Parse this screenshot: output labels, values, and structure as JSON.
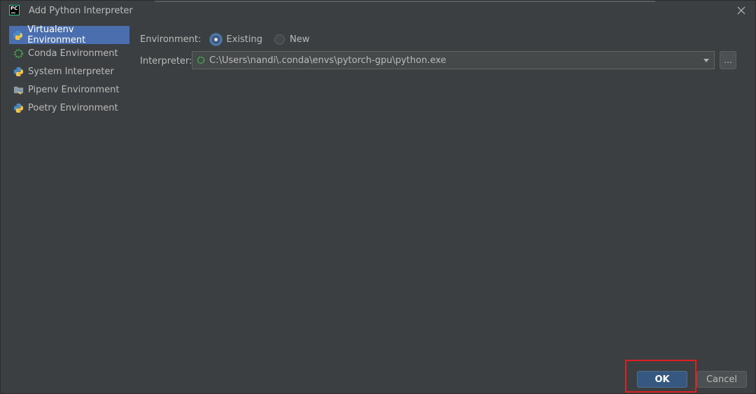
{
  "window": {
    "title": "Add Python Interpreter",
    "app_icon_text": "PC"
  },
  "sidebar": {
    "items": [
      {
        "label": "Virtualenv Environment",
        "icon": "python-icon",
        "selected": true
      },
      {
        "label": "Conda Environment",
        "icon": "conda-ring-icon",
        "selected": false
      },
      {
        "label": "System Interpreter",
        "icon": "python-icon",
        "selected": false
      },
      {
        "label": "Pipenv Environment",
        "icon": "pipenv-folder-icon",
        "selected": false
      },
      {
        "label": "Poetry Environment",
        "icon": "python-icon",
        "selected": false
      }
    ]
  },
  "main": {
    "environment_label": "Environment:",
    "env_options": [
      {
        "label": "Existing",
        "selected": true
      },
      {
        "label": "New",
        "selected": false
      }
    ],
    "interpreter_label": "Interpreter:",
    "interpreter_value": "C:\\Users\\nandi\\.conda\\envs\\pytorch-gpu\\python.exe",
    "browse_label": "..."
  },
  "buttons": {
    "ok_label": "OK",
    "cancel_label": "Cancel"
  },
  "colors": {
    "background": "#3c3f41",
    "selection": "#4b6eaf",
    "ok_button": "#365880",
    "highlight_box": "#e02020"
  }
}
